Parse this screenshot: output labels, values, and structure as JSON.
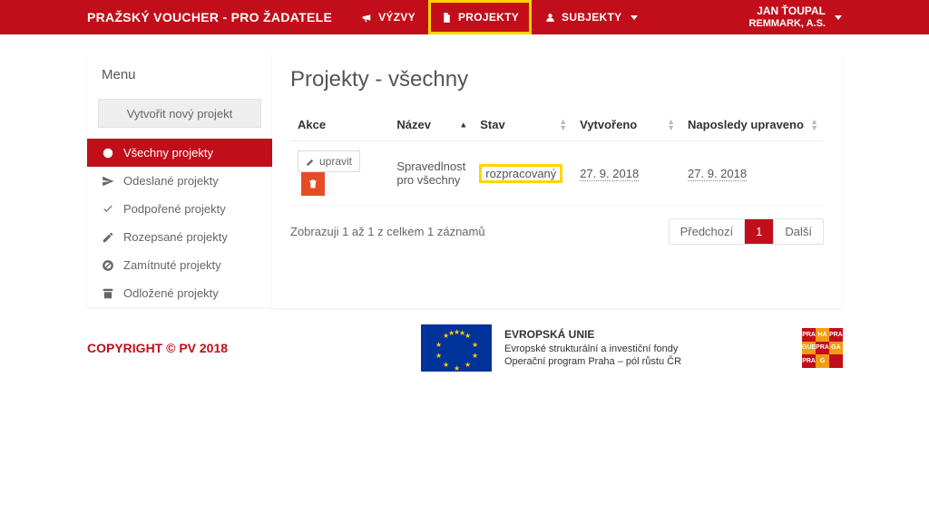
{
  "header": {
    "brand": "PRAŽSKÝ VOUCHER - PRO ŽADATELE",
    "nav": [
      {
        "label": "VÝZVY"
      },
      {
        "label": "PROJEKTY",
        "active": true
      },
      {
        "label": "SUBJEKTY",
        "dropdown": true
      }
    ],
    "user": {
      "name": "JAN ŤOUPAL",
      "org": "REMMARK, A.S."
    }
  },
  "sidebar": {
    "title": "Menu",
    "create_button": "Vytvořit nový projekt",
    "items": [
      {
        "label": "Všechny projekty",
        "icon": "dash"
      },
      {
        "label": "Odeslané projekty",
        "icon": "send"
      },
      {
        "label": "Podpořené projekty",
        "icon": "check"
      },
      {
        "label": "Rozepsané projekty",
        "icon": "pencil"
      },
      {
        "label": "Zamítnuté projekty",
        "icon": "ban"
      },
      {
        "label": "Odložené projekty",
        "icon": "archive"
      }
    ]
  },
  "main": {
    "title": "Projekty - všechny",
    "columns": {
      "action": "Akce",
      "name": "Název",
      "status": "Stav",
      "created": "Vytvořeno",
      "updated": "Naposledy upraveno"
    },
    "edit_label": "upravit",
    "rows": [
      {
        "name": "Spravedlnost pro všechny",
        "status": "rozpracovaný",
        "created": "27. 9. 2018",
        "updated": "27. 9. 2018"
      }
    ],
    "pager": {
      "info": "Zobrazuji 1 až 1 z celkem 1 záznamů",
      "prev": "Předchozí",
      "current": "1",
      "next": "Další"
    }
  },
  "footer": {
    "copyright": "COPYRIGHT © PV 2018",
    "eu": {
      "title": "EVROPSKÁ UNIE",
      "line1": "Evropské strukturální a investiční fondy",
      "line2": "Operační program Praha – pól růstu ČR"
    },
    "prague_tiles": [
      "PRA",
      "HA",
      "PRA",
      "GUE",
      "PRA",
      "GA",
      "PRA",
      "G",
      ""
    ]
  }
}
